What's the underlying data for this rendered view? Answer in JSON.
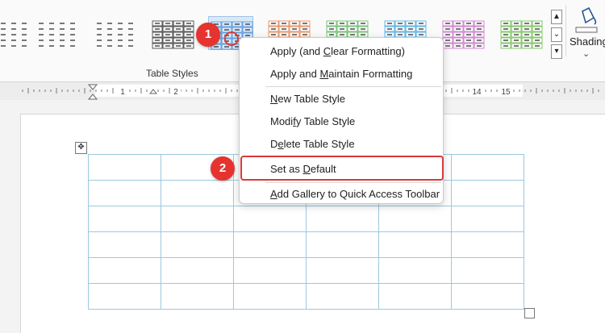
{
  "ribbon": {
    "group_label": "Table Styles",
    "shading_label": "Shading",
    "shading_chevron": "⌄",
    "gallery_scroll_up": "▲",
    "gallery_scroll_down": "⌄",
    "gallery_more": "▾",
    "styles": [
      {
        "name": "plain-1",
        "color": "#222222"
      },
      {
        "name": "plain-2",
        "color": "#222222"
      },
      {
        "name": "plain-3",
        "color": "#222222"
      },
      {
        "name": "grid-dark",
        "color": "#333333"
      },
      {
        "name": "grid-blue",
        "color": "#4a90d9"
      },
      {
        "name": "grid-orange",
        "color": "#e8834a"
      },
      {
        "name": "grid-green",
        "color": "#5cb85c"
      },
      {
        "name": "grid-cyan",
        "color": "#3ea8e0"
      },
      {
        "name": "grid-magenta",
        "color": "#c86fc9"
      },
      {
        "name": "grid-lime",
        "color": "#6cc04a"
      }
    ]
  },
  "ruler": {
    "labels": [
      "1",
      "2",
      "14",
      "15"
    ]
  },
  "context_menu": {
    "items": [
      {
        "pre": "Apply (and ",
        "key": "C",
        "post": "lear Formatting)"
      },
      {
        "pre": "Apply and ",
        "key": "M",
        "post": "aintain Formatting"
      },
      {
        "pre": "",
        "key": "N",
        "post": "ew Table Style"
      },
      {
        "pre": "Modi",
        "key": "f",
        "post": "y Table Style"
      },
      {
        "pre": "D",
        "key": "e",
        "post": "lete Table Style"
      },
      {
        "pre": "Set as ",
        "key": "D",
        "post": "efault"
      },
      {
        "pre": "",
        "key": "A",
        "post": "dd Gallery to Quick Access Toolbar"
      }
    ]
  },
  "annotations": {
    "step1": "1",
    "step2": "2",
    "accent": "#e5332f"
  },
  "document": {
    "table_rows": 6,
    "table_cols": 6,
    "border_color": "#9cc8de",
    "move_handle_icon": "✥"
  }
}
